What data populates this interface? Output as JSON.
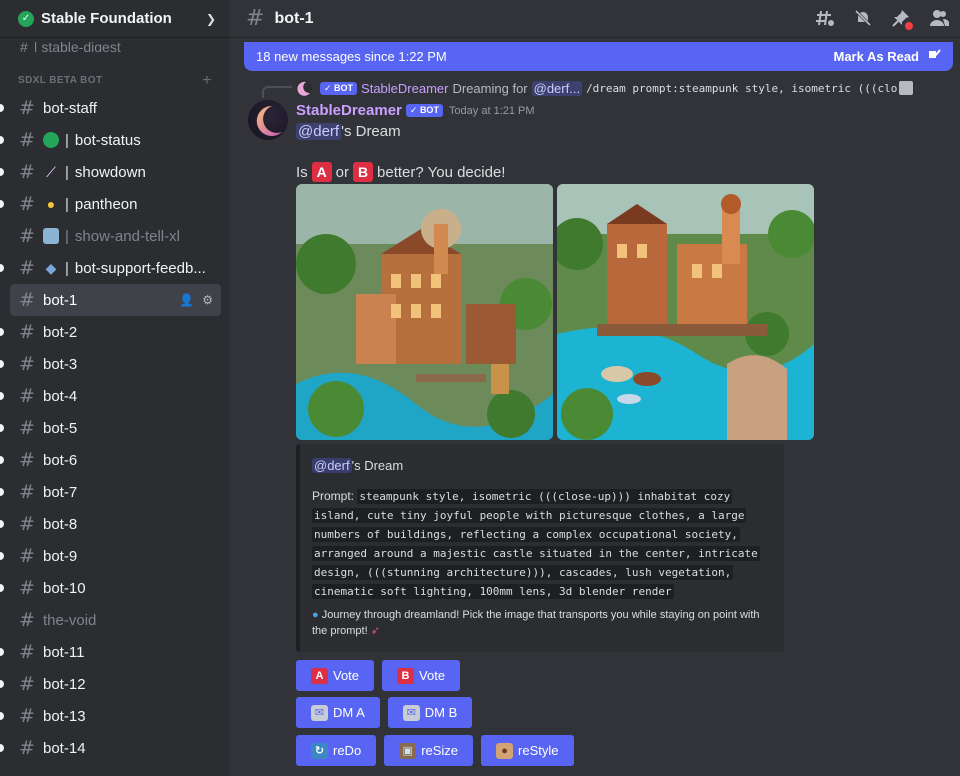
{
  "server": {
    "name": "Stable Foundation"
  },
  "digest": {
    "label": "| stable-digest"
  },
  "category": {
    "label": "SDXL BETA BOT"
  },
  "channels": [
    {
      "label": "bot-staff",
      "emoji": "",
      "unread": true,
      "muted": false
    },
    {
      "label": "bot-status",
      "emoji": "green-circle",
      "unread": true,
      "muted": false
    },
    {
      "label": "showdown",
      "emoji": "magic-wand",
      "unread": true,
      "muted": false
    },
    {
      "label": "pantheon",
      "emoji": "medal",
      "unread": true,
      "muted": false
    },
    {
      "label": "show-and-tell-xl",
      "emoji": "framed-picture",
      "unread": false,
      "muted": true
    },
    {
      "label": "bot-support-feedb...",
      "emoji": "speech-bubble",
      "unread": true,
      "muted": false
    },
    {
      "label": "bot-1",
      "active": true
    },
    {
      "label": "bot-2",
      "unread": true
    },
    {
      "label": "bot-3",
      "unread": true
    },
    {
      "label": "bot-4",
      "unread": true
    },
    {
      "label": "bot-5",
      "unread": true
    },
    {
      "label": "bot-6",
      "unread": true
    },
    {
      "label": "bot-7",
      "unread": true
    },
    {
      "label": "bot-8",
      "unread": true
    },
    {
      "label": "bot-9",
      "unread": true
    },
    {
      "label": "bot-10",
      "unread": true
    },
    {
      "label": "the-void",
      "muted": true
    },
    {
      "label": "bot-11",
      "unread": true
    },
    {
      "label": "bot-12",
      "unread": true
    },
    {
      "label": "bot-13",
      "unread": true
    },
    {
      "label": "bot-14",
      "unread": true
    }
  ],
  "topbar": {
    "title": "bot-1"
  },
  "new_messages": {
    "text": "18 new messages since 1:22 PM",
    "mark_read": "Mark As Read"
  },
  "reply": {
    "bot_tag": "BOT",
    "user": "StableDreamer",
    "text": "Dreaming for",
    "mention": "@derf...",
    "command": "/dream prompt:steampunk style, isometric (((clo"
  },
  "message": {
    "author": "StableDreamer",
    "bot_tag": "BOT",
    "timestamp": "Today at 1:21 PM",
    "mention": "@derf",
    "line1_suffix": "'s Dream",
    "line2_prefix": "Is",
    "a": "A",
    "or": "or",
    "b": "B",
    "line2_suffix": "better? You decide!"
  },
  "embed": {
    "mention": "@derf",
    "title_suffix": "'s Dream",
    "prompt_label": "Prompt:",
    "prompt_lines": [
      "steampunk style, isometric (((close-up))) inhabitat cozy",
      "island, cute tiny joyful people with picturesque clothes, a large",
      "numbers of buildings, reflecting a complex occupational society,",
      "arranged around a majestic castle situated in the center, intricate",
      "design, (((stunning architecture))), cascades, lush vegetation,",
      "cinematic soft lighting, 100mm lens, 3d blender render"
    ],
    "footer": "Journey through dreamland! Pick the image that transports you while staying on point with the prompt!"
  },
  "buttons": {
    "vote_a": "Vote",
    "vote_b": "Vote",
    "dm_a": "DM A",
    "dm_b": "DM B",
    "redo": "reDo",
    "resize": "reSize",
    "restyle": "reStyle",
    "a": "A",
    "b": "B"
  }
}
